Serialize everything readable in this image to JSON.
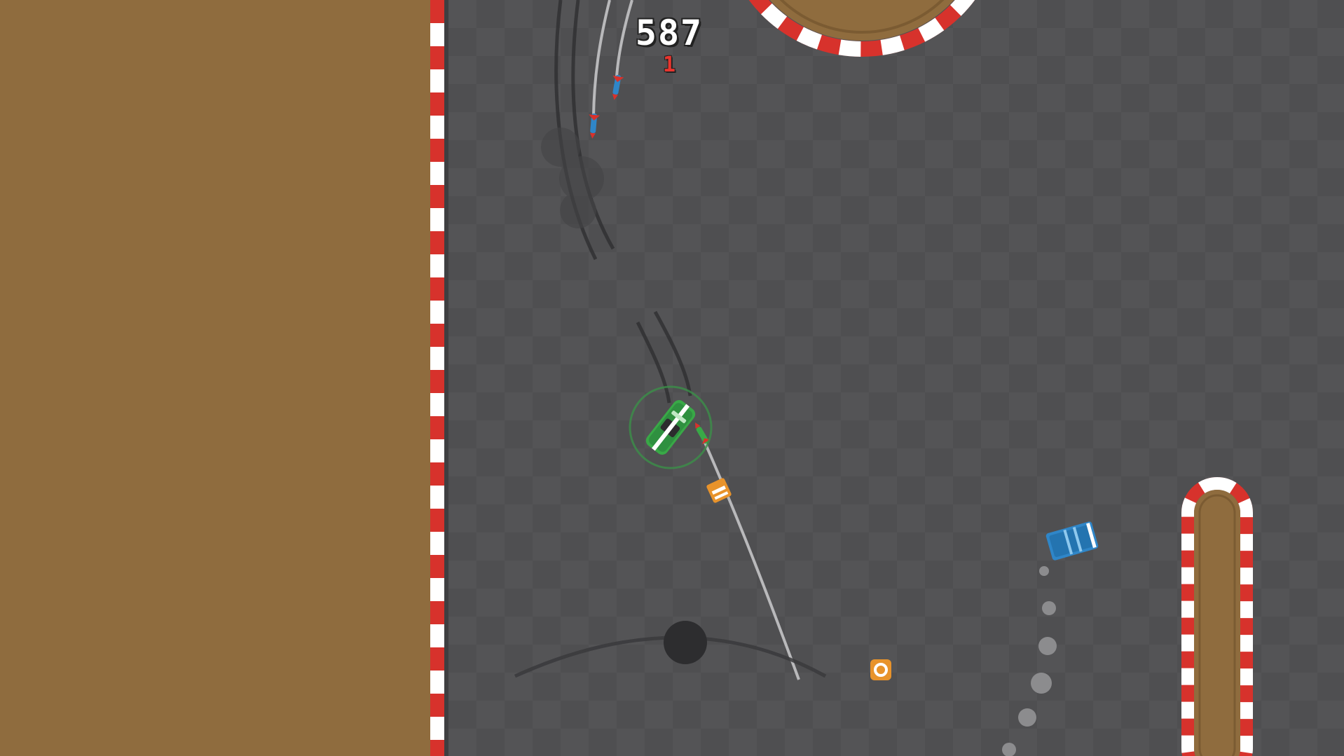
{
  "hud": {
    "score": "587",
    "combo": "1"
  },
  "colors": {
    "dirt": "#8f6c3e",
    "asphalt": "#4f4f51",
    "asphalt_tile": "#545456",
    "curb_red": "#d7322c",
    "curb_white": "#ffffff",
    "player_car": "#39a947",
    "opponent_truck": "#2f86c8",
    "pickup": "#e8932b",
    "score_text": "#ffffff",
    "combo_text": "#e8352e"
  },
  "icons": {
    "player": "green-race-car-icon",
    "opponent": "blue-truck-icon",
    "missile": "missile-icon",
    "pickup": "coin-pickup-icon",
    "crate": "orange-crate-icon",
    "joystick": "joystick-knob-icon"
  }
}
